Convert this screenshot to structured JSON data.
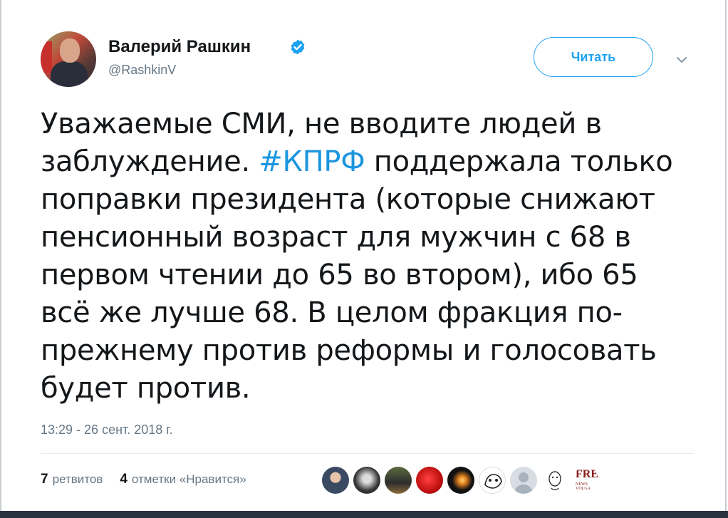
{
  "author": {
    "name": "Валерий Рашкин",
    "handle": "@RashkinV",
    "verified": true
  },
  "follow_button": {
    "label": "Читать"
  },
  "tweet": {
    "lines": [
      [
        "Уважаемые СМИ, не вводите людей в"
      ],
      [
        "заблуждение. ",
        "#КПРФ",
        " поддержала только"
      ],
      [
        "поправки президента (которые снижают"
      ],
      [
        "пенсионный возраст для мужчин с 68 в"
      ],
      [
        "первом чтении до 65 во втором), ибо 65"
      ],
      [
        "всё же лучше 68. В целом фракция по-"
      ],
      [
        "прежнему против реформы и голосовать"
      ],
      [
        "будет против."
      ]
    ],
    "hashtag": "#КПРФ"
  },
  "timestamp": "13:29 - 26 сент. 2018 г.",
  "stats": {
    "retweets_count": "7",
    "retweets_label": "ретвитов",
    "likes_count": "4",
    "likes_label": "отметки «Нравится»"
  },
  "likers": [
    {
      "name": "liker-1"
    },
    {
      "name": "liker-2"
    },
    {
      "name": "liker-3"
    },
    {
      "name": "liker-4"
    },
    {
      "name": "liker-5"
    },
    {
      "name": "liker-6"
    },
    {
      "name": "liker-7"
    },
    {
      "name": "liker-8"
    },
    {
      "name": "liker-9"
    }
  ],
  "liker_logo_text": {
    "top": "FREE",
    "bottom": "NEWS VOLGA"
  },
  "colors": {
    "accent": "#1da1f2",
    "hashtag": "#1b95e0",
    "text": "#14171a",
    "muted": "#657786"
  }
}
